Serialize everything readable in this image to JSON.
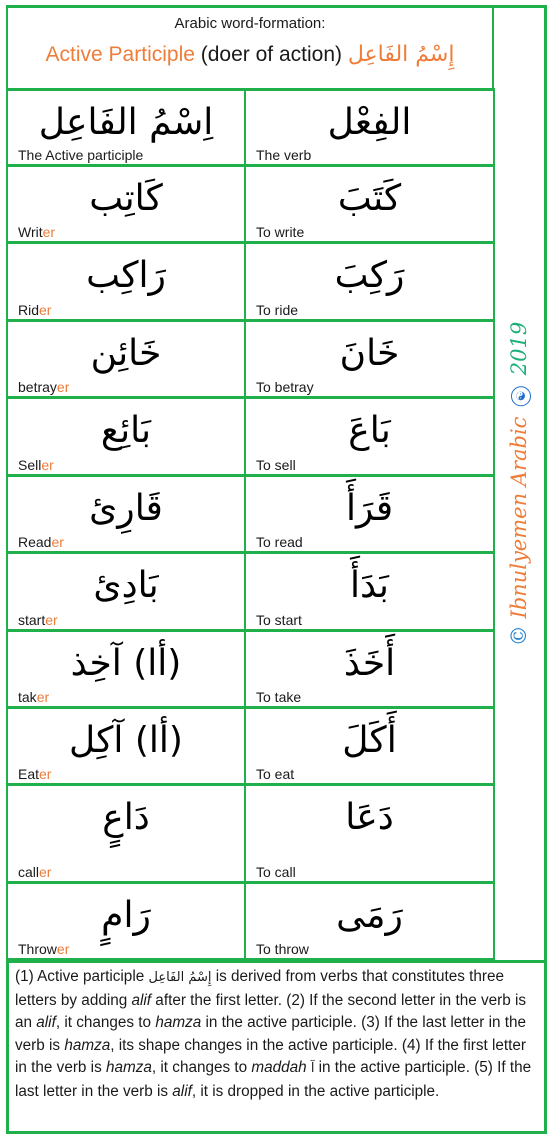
{
  "header": {
    "subtitle": "Arabic word-formation:",
    "title_highlight": "Active Participle",
    "title_rest": " (doer of action) ",
    "title_arabic": "إِسْمُ الفَاعِل"
  },
  "sidebar": {
    "copyright_symbol": "©",
    "brand": " Ibnulyemen Arabic ",
    "logo_glyph": "☯",
    "year": " 2019"
  },
  "colors": {
    "border": "#1fb04c",
    "accent_orange": "#ee7d3a",
    "diacritic_red": "#e03030",
    "copyright_blue": "#1f7fd0"
  },
  "table": {
    "rows": [
      {
        "participle_ar": "اِسْمُ الفَاعِل",
        "participle_en": "The Active participle",
        "participle_en_suffix": "",
        "verb_ar": "الفِعْل",
        "verb_en": "The verb"
      },
      {
        "participle_ar": "كَاتِب",
        "participle_en": "Writ",
        "participle_en_suffix": "er",
        "verb_ar": "كَتَبَ",
        "verb_en": "To write"
      },
      {
        "participle_ar": "رَاكِب",
        "participle_en": "Rid",
        "participle_en_suffix": "er",
        "verb_ar": "رَكِبَ",
        "verb_en": "To ride"
      },
      {
        "participle_ar": "خَائِن",
        "participle_en": "betray",
        "participle_en_suffix": "er",
        "verb_ar": "خَانَ",
        "verb_en": "To betray"
      },
      {
        "participle_ar": "بَائِع",
        "participle_en": "Sell",
        "participle_en_suffix": "er",
        "verb_ar": "بَاعَ",
        "verb_en": "To sell"
      },
      {
        "participle_ar": "قَارِئ",
        "participle_en": "Read",
        "participle_en_suffix": "er",
        "verb_ar": "قَرَأَ",
        "verb_en": "To read"
      },
      {
        "participle_ar": "بَادِئ",
        "participle_en": "start",
        "participle_en_suffix": "er",
        "verb_ar": "بَدَأَ",
        "verb_en": "To start"
      },
      {
        "participle_ar": "(أا) آخِذ",
        "participle_en": "tak",
        "participle_en_suffix": "er",
        "verb_ar": "أَخَذَ",
        "verb_en": "To take"
      },
      {
        "participle_ar": "(أا) آكِل",
        "participle_en": "Eat",
        "participle_en_suffix": "er",
        "verb_ar": "أَكَلَ",
        "verb_en": "To eat"
      },
      {
        "participle_ar": "دَاعٍ",
        "participle_en": "call",
        "participle_en_suffix": "er",
        "verb_ar": "دَعَا",
        "verb_en": "To call"
      },
      {
        "participle_ar": "رَامٍ",
        "participle_en": "Throw",
        "participle_en_suffix": "er",
        "verb_ar": "رَمَى",
        "verb_en": "To throw"
      }
    ]
  },
  "notes": {
    "p1": "(1) Active participle ",
    "p1_ar": "إِسْمُ الفَاعِل",
    "p2": " is derived from verbs that constitutes three letters by adding ",
    "alif1": "alif",
    "p3": " after the first letter. (2) If the second letter in the verb is an ",
    "alif2": "alif",
    "p4": ", it changes to ",
    "hamza1": "hamza",
    "p5": " in the active participle. (3) If the last letter in the verb is ",
    "hamza2": "hamza",
    "p6": ", its shape changes in the active participle. (4) If the first letter in the verb is ",
    "hamza3": "hamza",
    "p7": ", it changes to ",
    "maddah": "maddah",
    "maddah_ar": " آ ",
    "p8": "in the active participle. (5) If the last letter in the verb is ",
    "alif3": "alif",
    "p9": ", it is dropped in the active participle."
  }
}
